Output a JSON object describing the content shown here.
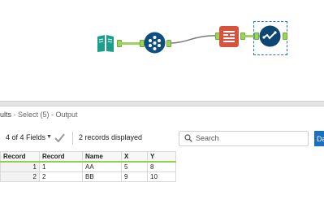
{
  "colors": {
    "accent": "#1b6ec2",
    "anchor_green": "#9bd25a",
    "input_tool": "#1aa08a",
    "preparation_tool": "#0f4e7e",
    "developer_tool": "#d9533c",
    "browse_tool": "#0d4673",
    "header_underline": "#8fd14f"
  },
  "workflow": {
    "tools": [
      {
        "name": "Input Data",
        "icon": "book-icon"
      },
      {
        "name": "Select",
        "icon": "select-icon"
      },
      {
        "name": "Dynamic Input",
        "icon": "dynamic-input-icon"
      },
      {
        "name": "Browse",
        "icon": "browse-icon"
      }
    ]
  },
  "results": {
    "header_prefix": "ults",
    "header_suffix": " - Select (5) - Output",
    "fields_label": "4 of 4 Fields",
    "records_label": "2 records displayed",
    "search_placeholder": "Search",
    "data_button": "Da",
    "columns": [
      "Record",
      "Record",
      "Name",
      "X",
      "Y"
    ],
    "rows": [
      {
        "num": "1",
        "Record": "1",
        "Name": "AA",
        "X": "5",
        "Y": "8"
      },
      {
        "num": "2",
        "Record": "2",
        "Name": "BB",
        "X": "9",
        "Y": "10"
      }
    ]
  }
}
